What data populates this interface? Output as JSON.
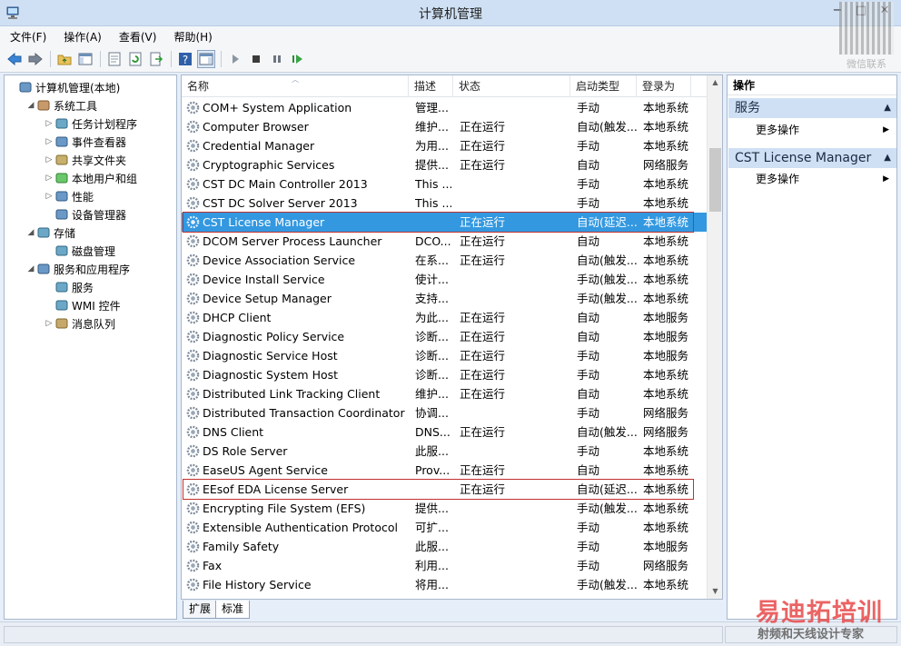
{
  "window": {
    "title": "计算机管理",
    "minimize": "−",
    "maximize": "□",
    "close": "✕"
  },
  "menu": [
    "文件(F)",
    "操作(A)",
    "查看(V)",
    "帮助(H)"
  ],
  "tree": [
    {
      "label": "计算机管理(本地)",
      "level": 0,
      "expander": "",
      "icon": "computer-management-icon"
    },
    {
      "label": "系统工具",
      "level": 1,
      "expander": "◢",
      "icon": "system-tools-icon"
    },
    {
      "label": "任务计划程序",
      "level": 2,
      "expander": "▷",
      "icon": "task-scheduler-icon"
    },
    {
      "label": "事件查看器",
      "level": 2,
      "expander": "▷",
      "icon": "event-viewer-icon"
    },
    {
      "label": "共享文件夹",
      "level": 2,
      "expander": "▷",
      "icon": "shared-folders-icon"
    },
    {
      "label": "本地用户和组",
      "level": 2,
      "expander": "▷",
      "icon": "local-users-icon"
    },
    {
      "label": "性能",
      "level": 2,
      "expander": "▷",
      "icon": "performance-icon"
    },
    {
      "label": "设备管理器",
      "level": 2,
      "expander": "",
      "icon": "device-manager-icon"
    },
    {
      "label": "存储",
      "level": 1,
      "expander": "◢",
      "icon": "storage-icon"
    },
    {
      "label": "磁盘管理",
      "level": 2,
      "expander": "",
      "icon": "disk-management-icon"
    },
    {
      "label": "服务和应用程序",
      "level": 1,
      "expander": "◢",
      "icon": "services-apps-icon"
    },
    {
      "label": "服务",
      "level": 2,
      "expander": "",
      "icon": "services-icon",
      "selected": true
    },
    {
      "label": "WMI 控件",
      "level": 2,
      "expander": "",
      "icon": "wmi-icon"
    },
    {
      "label": "消息队列",
      "level": 2,
      "expander": "▷",
      "icon": "message-queue-icon"
    }
  ],
  "columns": [
    "名称",
    "描述",
    "状态",
    "启动类型",
    "登录为"
  ],
  "services": [
    {
      "name": "COM+ System Application",
      "desc": "管理...",
      "status": "",
      "startup": "手动",
      "logon": "本地系统"
    },
    {
      "name": "Computer Browser",
      "desc": "维护...",
      "status": "正在运行",
      "startup": "自动(触发...",
      "logon": "本地系统"
    },
    {
      "name": "Credential Manager",
      "desc": "为用...",
      "status": "正在运行",
      "startup": "手动",
      "logon": "本地系统"
    },
    {
      "name": "Cryptographic Services",
      "desc": "提供...",
      "status": "正在运行",
      "startup": "自动",
      "logon": "网络服务"
    },
    {
      "name": "CST DC Main Controller 2013",
      "desc": "This ...",
      "status": "",
      "startup": "手动",
      "logon": "本地系统"
    },
    {
      "name": "CST DC Solver Server 2013",
      "desc": "This ...",
      "status": "",
      "startup": "手动",
      "logon": "本地系统"
    },
    {
      "name": "CST License Manager",
      "desc": "",
      "status": "正在运行",
      "startup": "自动(延迟...",
      "logon": "本地系统",
      "selected": true,
      "boxed": true
    },
    {
      "name": "DCOM Server Process Launcher",
      "desc": "DCO...",
      "status": "正在运行",
      "startup": "自动",
      "logon": "本地系统"
    },
    {
      "name": "Device Association Service",
      "desc": "在系...",
      "status": "正在运行",
      "startup": "自动(触发...",
      "logon": "本地系统"
    },
    {
      "name": "Device Install Service",
      "desc": "使计...",
      "status": "",
      "startup": "手动(触发...",
      "logon": "本地系统"
    },
    {
      "name": "Device Setup Manager",
      "desc": "支持...",
      "status": "",
      "startup": "手动(触发...",
      "logon": "本地系统"
    },
    {
      "name": "DHCP Client",
      "desc": "为此...",
      "status": "正在运行",
      "startup": "自动",
      "logon": "本地服务"
    },
    {
      "name": "Diagnostic Policy Service",
      "desc": "诊断...",
      "status": "正在运行",
      "startup": "自动",
      "logon": "本地服务"
    },
    {
      "name": "Diagnostic Service Host",
      "desc": "诊断...",
      "status": "正在运行",
      "startup": "手动",
      "logon": "本地服务"
    },
    {
      "name": "Diagnostic System Host",
      "desc": "诊断...",
      "status": "正在运行",
      "startup": "手动",
      "logon": "本地系统"
    },
    {
      "name": "Distributed Link Tracking Client",
      "desc": "维护...",
      "status": "正在运行",
      "startup": "自动",
      "logon": "本地系统"
    },
    {
      "name": "Distributed Transaction Coordinator",
      "desc": "协调...",
      "status": "",
      "startup": "手动",
      "logon": "网络服务"
    },
    {
      "name": "DNS Client",
      "desc": "DNS...",
      "status": "正在运行",
      "startup": "自动(触发...",
      "logon": "网络服务"
    },
    {
      "name": "DS Role Server",
      "desc": "此服...",
      "status": "",
      "startup": "手动",
      "logon": "本地系统"
    },
    {
      "name": "EaseUS Agent Service",
      "desc": "Prov...",
      "status": "正在运行",
      "startup": "自动",
      "logon": "本地系统"
    },
    {
      "name": "EEsof EDA License Server",
      "desc": "",
      "status": "正在运行",
      "startup": "自动(延迟...",
      "logon": "本地系统",
      "boxed": true
    },
    {
      "name": "Encrypting File System (EFS)",
      "desc": "提供...",
      "status": "",
      "startup": "手动(触发...",
      "logon": "本地系统"
    },
    {
      "name": "Extensible Authentication Protocol",
      "desc": "可扩...",
      "status": "",
      "startup": "手动",
      "logon": "本地系统"
    },
    {
      "name": "Family Safety",
      "desc": "此服...",
      "status": "",
      "startup": "手动",
      "logon": "本地服务"
    },
    {
      "name": "Fax",
      "desc": "利用...",
      "status": "",
      "startup": "手动",
      "logon": "网络服务"
    },
    {
      "name": "File History Service",
      "desc": "将用...",
      "status": "",
      "startup": "手动(触发...",
      "logon": "本地系统"
    }
  ],
  "tabs": [
    "扩展",
    "标准"
  ],
  "actions": {
    "title": "操作",
    "section1": "服务",
    "section1_item": "更多操作",
    "section2": "CST License Manager",
    "section2_item": "更多操作"
  },
  "watermark": {
    "qr_caption": "微信联系",
    "brand": "易迪拓培训",
    "sub": "射频和天线设计专家"
  }
}
